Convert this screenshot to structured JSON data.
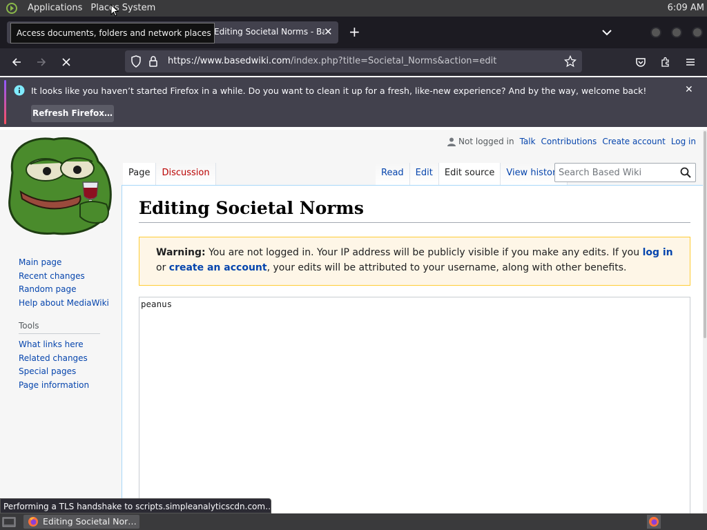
{
  "top_panel": {
    "applications": "Applications",
    "places": "Places",
    "system": "System",
    "clock": "6:09 AM"
  },
  "tooltip": "Access documents, folders and network places",
  "tab": {
    "title": "Editing Societal Norms - Based Wiki"
  },
  "url": {
    "host": "https://www.basedwiki.com",
    "path": "/index.php?title=Societal_Norms&action=edit"
  },
  "notification": {
    "message": "It looks like you haven’t started Firefox in a while. Do you want to clean it up for a fresh, like-new experience? And by the way, welcome back!",
    "button": "Refresh Firefox…"
  },
  "personal": {
    "not_logged_in": "Not logged in",
    "talk": "Talk",
    "contributions": "Contributions",
    "create_account": "Create account",
    "log_in": "Log in"
  },
  "tabs": {
    "page": "Page",
    "discussion": "Discussion",
    "read": "Read",
    "edit": "Edit",
    "edit_source": "Edit source",
    "view_history": "View history"
  },
  "search": {
    "placeholder": "Search Based Wiki"
  },
  "sidebar": {
    "navigation": [
      "Main page",
      "Recent changes",
      "Random page",
      "Help about MediaWiki"
    ],
    "tools_heading": "Tools",
    "tools": [
      "What links here",
      "Related changes",
      "Special pages",
      "Page information"
    ]
  },
  "content": {
    "title": "Editing Societal Norms",
    "warning_label": "Warning:",
    "warning_text_1": " You are not logged in. Your IP address will be publicly visible if you make any edits. If you ",
    "warning_link_1": "log in",
    "warning_text_2": " or ",
    "warning_link_2": "create an account",
    "warning_text_3": ", your edits will be attributed to your username, along with other benefits.",
    "editor_text": "peanus"
  },
  "status": "Performing a TLS handshake to scripts.simpleanalyticscdn.com…",
  "taskbar": {
    "task_label": "Editing Societal Nor…"
  }
}
